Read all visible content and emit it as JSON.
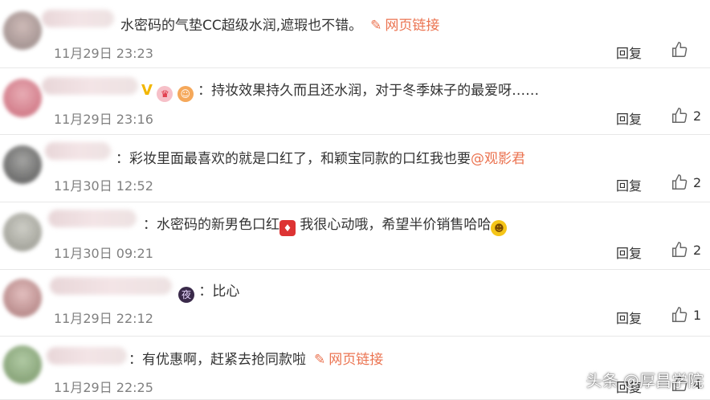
{
  "comments": [
    {
      "text": "水密码的气垫CC超级水润,遮瑕也不错。",
      "link": "网页链接",
      "time": "11月29日 23:23",
      "reply": "回复",
      "likes": ""
    },
    {
      "prefix": "：",
      "text": "持妆效果持久而且还水润，对于冬季妹子的最爱呀……",
      "time": "11月29日 23:16",
      "reply": "回复",
      "likes": "2"
    },
    {
      "prefix": "：",
      "text": "彩妆里面最喜欢的就是口红了，和颖宝同款的口红我也要",
      "mention": "@观影君",
      "time": "11月30日 12:52",
      "reply": "回复",
      "likes": "2"
    },
    {
      "prefix": "：",
      "text": "水密码的新男色口红",
      "text2": "我很心动哦，希望半价销售哈哈",
      "time": "11月30日 09:21",
      "reply": "回复",
      "likes": "2"
    },
    {
      "prefix": "：",
      "text": "比心",
      "time": "11月29日 22:12",
      "reply": "回复",
      "likes": "1"
    },
    {
      "prefix": "：",
      "text": "有优惠啊，赶紧去抢同款啦",
      "link": "网页链接",
      "time": "11月29日 22:25",
      "reply": "回复",
      "likes": "4"
    }
  ],
  "watermark": "头条 @厚昌学院",
  "colors": {
    "link": "#eb7350",
    "time": "#808080",
    "text": "#333333"
  }
}
